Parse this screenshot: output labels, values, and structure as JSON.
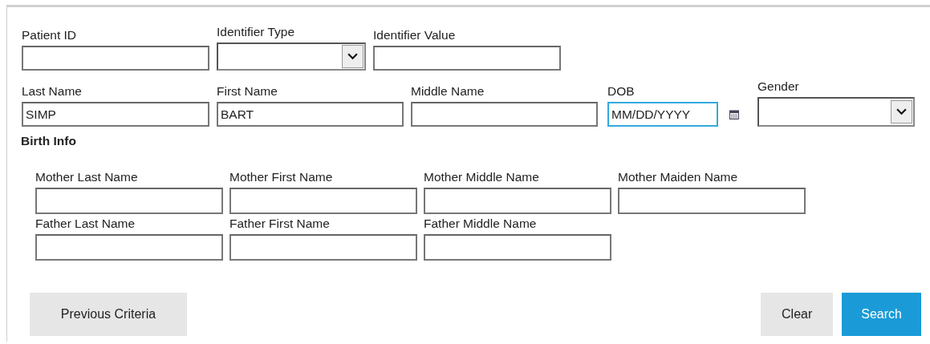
{
  "top_rows": [
    {
      "fields": [
        {
          "label": "Patient ID",
          "kind": "text",
          "focused": false
        },
        {
          "label": "Identifier Type",
          "kind": "select",
          "focused": false
        },
        {
          "label": "Identifier Value",
          "kind": "text",
          "focused": false
        }
      ]
    },
    {
      "fields": [
        {
          "label": "Last Name",
          "kind": "text",
          "value": "SIMP",
          "focused": false
        },
        {
          "label": "First Name",
          "kind": "text",
          "value": "BART",
          "focused": false
        },
        {
          "label": "Middle Name",
          "kind": "text",
          "focused": false
        },
        {
          "label": "DOB",
          "kind": "date",
          "placeholder": "MM/DD/YYYY",
          "focused": true
        },
        {
          "label": "Gender",
          "kind": "select",
          "focused": false
        }
      ]
    }
  ],
  "birth_info": {
    "heading": "Birth Info",
    "rows": [
      {
        "fields": [
          {
            "label": "Mother Last Name",
            "kind": "text",
            "focused": false
          },
          {
            "label": "Mother First Name",
            "kind": "text",
            "focused": false
          },
          {
            "label": "Mother Middle Name",
            "kind": "text",
            "focused": false
          },
          {
            "label": "Mother Maiden Name",
            "kind": "text",
            "focused": false
          }
        ]
      },
      {
        "fields": [
          {
            "label": "Father Last Name",
            "kind": "text",
            "focused": false
          },
          {
            "label": "Father First Name",
            "kind": "text",
            "focused": false
          },
          {
            "label": "Father Middle Name",
            "kind": "text",
            "focused": false
          }
        ]
      }
    ]
  },
  "buttons": [
    {
      "label": "Previous Criteria",
      "kind": "secondary"
    },
    {
      "label": "Clear",
      "kind": "secondary"
    },
    {
      "label": "Search",
      "kind": "primary"
    }
  ]
}
